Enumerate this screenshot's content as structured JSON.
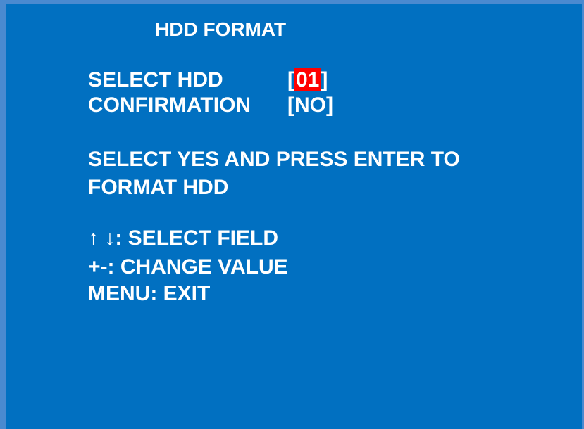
{
  "title": "HDD FORMAT",
  "fields": {
    "select_hdd": {
      "label": "SELECT HDD",
      "bracket_open": "[",
      "value": "01",
      "bracket_close": "]"
    },
    "confirmation": {
      "label": "CONFIRMATION",
      "value": "[NO]"
    }
  },
  "message": {
    "line1": "SELECT YES AND PRESS ENTER TO",
    "line2": "FORMAT HDD"
  },
  "help": {
    "up_arrow": "↑",
    "down_arrow": "↓",
    "select_field": ": SELECT FIELD",
    "change_value": "+-: CHANGE VALUE",
    "exit": "MENU: EXIT"
  },
  "colors": {
    "background": "#0170c1",
    "frame": "#4a8ad0",
    "text": "#ffffff",
    "highlight": "#ff0000"
  }
}
